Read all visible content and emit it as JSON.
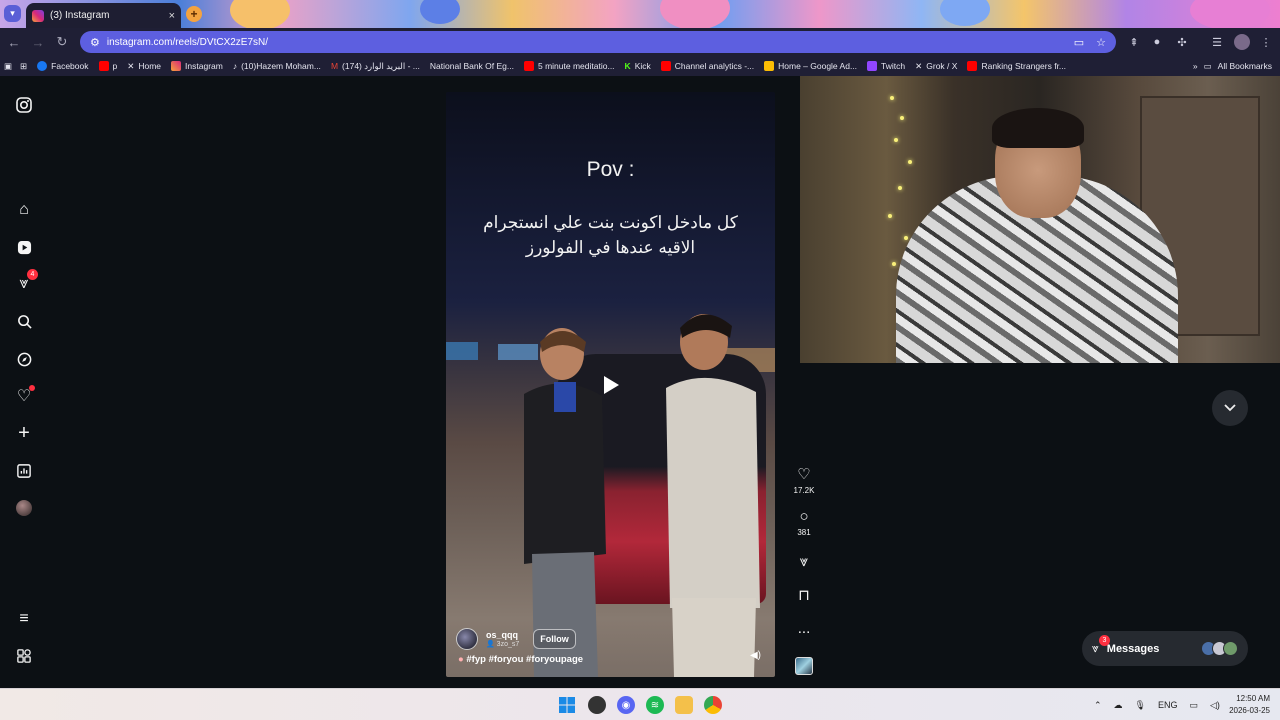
{
  "browser": {
    "tab_title": "(3) Instagram",
    "tab_close": "×",
    "new_tab": "+",
    "url": "instagram.com/reels/DVtCX2zE7sN/",
    "bookmarks": [
      {
        "label": "Facebook",
        "color": "#1877f2"
      },
      {
        "label": "p",
        "color": "#ff0000"
      },
      {
        "label": "Home",
        "color": "#000000"
      },
      {
        "label": "Instagram",
        "color": "#d7287a"
      },
      {
        "label": "(10)Hazem Moham...",
        "color": "#111111"
      },
      {
        "label": "(174) البريد الوارد - ...",
        "color": "#ea4335"
      },
      {
        "label": "National Bank Of Eg...",
        "color": "#2a7a3a"
      },
      {
        "label": "5 minute meditatio...",
        "color": "#ff0000"
      },
      {
        "label": "Kick",
        "color": "#53fc18"
      },
      {
        "label": "Channel analytics -...",
        "color": "#ff0000"
      },
      {
        "label": "Home – Google Ad...",
        "color": "#fbbc04"
      },
      {
        "label": "Twitch",
        "color": "#9146ff"
      },
      {
        "label": "Grok / X",
        "color": "#000000"
      },
      {
        "label": "Ranking Strangers fr...",
        "color": "#ff0000"
      }
    ],
    "all_bookmarks": "All Bookmarks"
  },
  "sidebar": {
    "notifications_count": "4"
  },
  "reel": {
    "pov": "Pov :",
    "arabic_line1": "كل مادخل اكونت بنت علي انستجرام",
    "arabic_line2": "الاقيه عندها في الفولورز",
    "author": "os_qqq",
    "author_sub": "3zo_s7",
    "follow": "Follow",
    "caption": "#fyp #foryou #foryoupage",
    "likes": "17.2K",
    "comments": "381",
    "more": "..."
  },
  "messages": {
    "label": "Messages",
    "badge": "3"
  },
  "taskbar": {
    "lang": "ENG",
    "time": "12:50 AM",
    "date": "2026-03-25"
  },
  "colors": {
    "ig_background": "#0c1014",
    "omnibox": "#5d5fe0",
    "badge": "#ff3040"
  }
}
